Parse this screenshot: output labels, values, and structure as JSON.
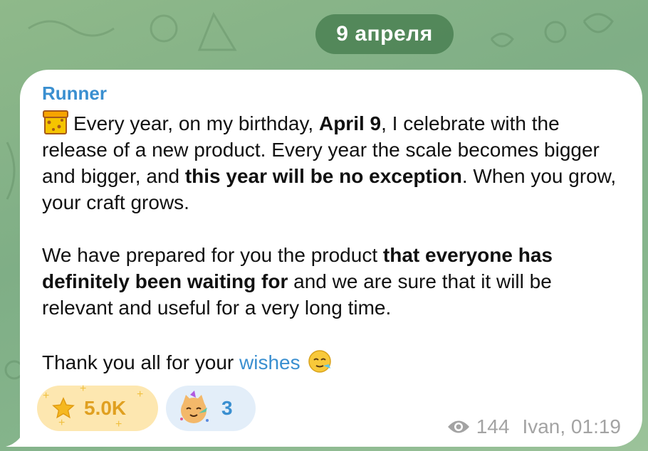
{
  "date_separator": "9 апреля",
  "message": {
    "sender": "Runner",
    "p1": {
      "t1": "Every year, on my birthday, ",
      "b1": "April 9",
      "t2": ", I celebrate with the release of a new product. Every year the scale becomes bigger and bigger, and ",
      "b2": "this year will be no exception",
      "t3": ". When you grow, your craft grows."
    },
    "p2": {
      "t1": "We have prepared for you the product ",
      "b1": "that everyone has definitely been waiting for",
      "t2": " and we are sure that it will be relevant and useful for a very long time."
    },
    "p3": {
      "t1": "Thank you all for your ",
      "link": "wishes"
    },
    "emoji_start": "gift-box-icon",
    "emoji_end": "party-face-icon"
  },
  "reactions": [
    {
      "icon": "star-icon",
      "count": "5.0K",
      "color": "#e0a020"
    },
    {
      "icon": "party-cat-icon",
      "count": "3",
      "color": "#3a8fd0"
    }
  ],
  "meta": {
    "views_icon": "eye-icon",
    "views": "144",
    "author_time": "Ivan, 01:19"
  },
  "colors": {
    "accent": "#3a8fd0",
    "date_pill": "#4a8052",
    "star_reaction_bg": "#fde7b0"
  }
}
